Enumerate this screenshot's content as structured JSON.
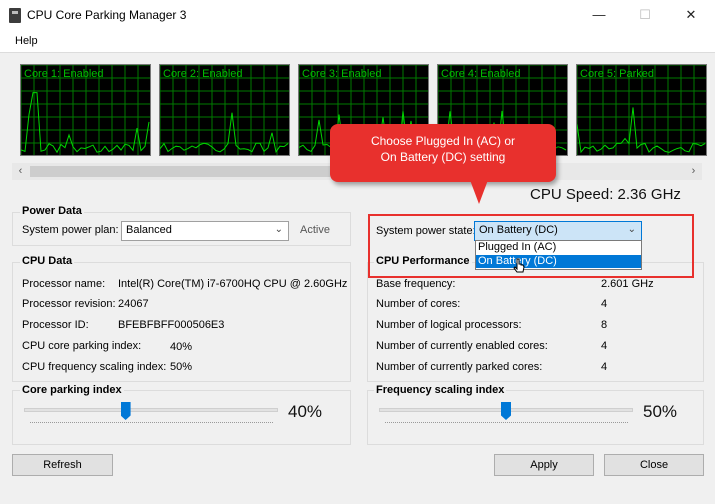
{
  "window": {
    "title": "CPU Core Parking Manager 3",
    "minimize": "—",
    "maximize": "☐",
    "close": "✕"
  },
  "menu": {
    "help": "Help"
  },
  "cores": [
    {
      "label": "Core 1: Enabled",
      "state": "Enabled"
    },
    {
      "label": "Core 2: Enabled",
      "state": "Enabled"
    },
    {
      "label": "Core 3: Enabled",
      "state": "Enabled"
    },
    {
      "label": "Core 4: Enabled",
      "state": "Enabled"
    },
    {
      "label": "Core 5: Parked",
      "state": "Parked"
    }
  ],
  "scroll": {
    "left": "‹",
    "right": "›"
  },
  "cpu_speed": "CPU Speed: 2.36 GHz",
  "power_data": {
    "title": "Power Data",
    "plan_label": "System power plan:",
    "plan_value": "Balanced",
    "plan_status": "Active",
    "state_label": "System power state:",
    "state_value": "On Battery (DC)",
    "state_options": [
      "Plugged In (AC)",
      "On Battery (DC)"
    ]
  },
  "callout": {
    "line1": "Choose Plugged In (AC) or",
    "line2": "On Battery (DC) setting"
  },
  "cpu_data": {
    "title": "CPU Data",
    "rows": [
      {
        "label": "Processor name:",
        "value": "Intel(R) Core(TM) i7-6700HQ CPU @ 2.60GHz"
      },
      {
        "label": "Processor revision:",
        "value": "24067"
      },
      {
        "label": "Processor ID:",
        "value": "BFEBFBFF000506E3"
      },
      {
        "label": "CPU core parking index:",
        "value": "40%"
      },
      {
        "label": "CPU frequency scaling index:",
        "value": "50%"
      }
    ]
  },
  "cpu_performance": {
    "title": "CPU Performance",
    "rows": [
      {
        "label": "Base frequency:",
        "value": "2.601 GHz"
      },
      {
        "label": "Number of cores:",
        "value": "4"
      },
      {
        "label": "Number of logical processors:",
        "value": "8"
      },
      {
        "label": "Number of currently enabled cores:",
        "value": "4"
      },
      {
        "label": "Number of currently parked cores:",
        "value": "4"
      }
    ]
  },
  "core_parking_index": {
    "title": "Core parking index",
    "value": 40,
    "display": "40%"
  },
  "frequency_scaling_index": {
    "title": "Frequency scaling index",
    "value": 50,
    "display": "50%"
  },
  "buttons": {
    "refresh": "Refresh",
    "apply": "Apply",
    "close": "Close"
  },
  "colors": {
    "graph_bg": "#000000",
    "graph_grid": "#007a00",
    "graph_line": "#00d800",
    "accent": "#0078d7",
    "callout": "#e8302d"
  }
}
